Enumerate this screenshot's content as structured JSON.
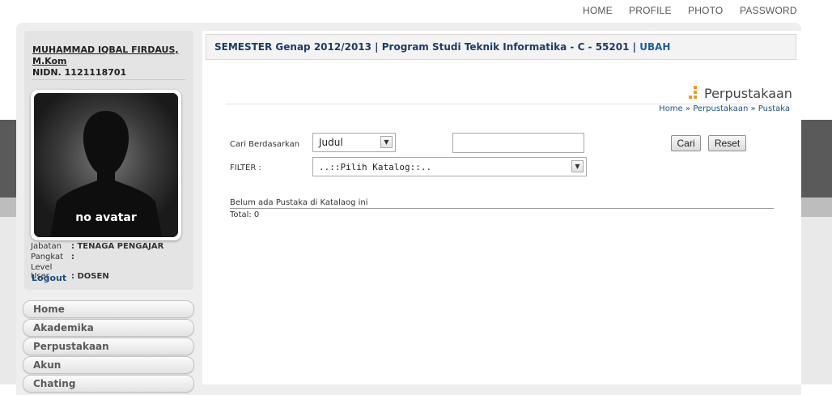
{
  "topnav": [
    {
      "label": "HOME"
    },
    {
      "label": "PROFILE"
    },
    {
      "label": "PHOTO"
    },
    {
      "label": "PASSWORD"
    }
  ],
  "user": {
    "name": "MUHAMMAD IQBAL FIRDAUS, M.Kom",
    "nidn": "NIDN. 1121118701",
    "avatar_text": "no avatar",
    "info": [
      {
        "label": "Jabatan",
        "value": ": TENAGA PENGAJAR"
      },
      {
        "label": "Pangkat",
        "value": ":"
      },
      {
        "label": "Level User",
        "value": ": DOSEN"
      }
    ],
    "logout": "Logout"
  },
  "sidebar": {
    "items": [
      {
        "label": "Home"
      },
      {
        "label": "Akademika"
      },
      {
        "label": "Perpustakaan"
      },
      {
        "label": "Akun"
      },
      {
        "label": "Chating"
      }
    ]
  },
  "semester": {
    "text": "SEMESTER Genap 2012/2013 | Program Studi Teknik Informatika - C - 55201 |",
    "link": "UBAH"
  },
  "page": {
    "title": "Perpustakaan",
    "breadcrumb": [
      "Home",
      "»",
      "Perpustakaan",
      "»",
      "Pustaka"
    ]
  },
  "search": {
    "label": "Cari Berdasarkan",
    "field_value": "Judul",
    "query": "",
    "search_button": "Cari",
    "reset_button": "Reset"
  },
  "filter": {
    "label": "FILTER :",
    "value": "..::Pilih Katalog::.."
  },
  "results": {
    "message": "Belum ada Pustaka di Katalaog ini",
    "total": "Total: 0"
  },
  "colors": {
    "accent": "#1d3c66",
    "link": "#1f5f99",
    "title_icon": "#f29a1f"
  }
}
